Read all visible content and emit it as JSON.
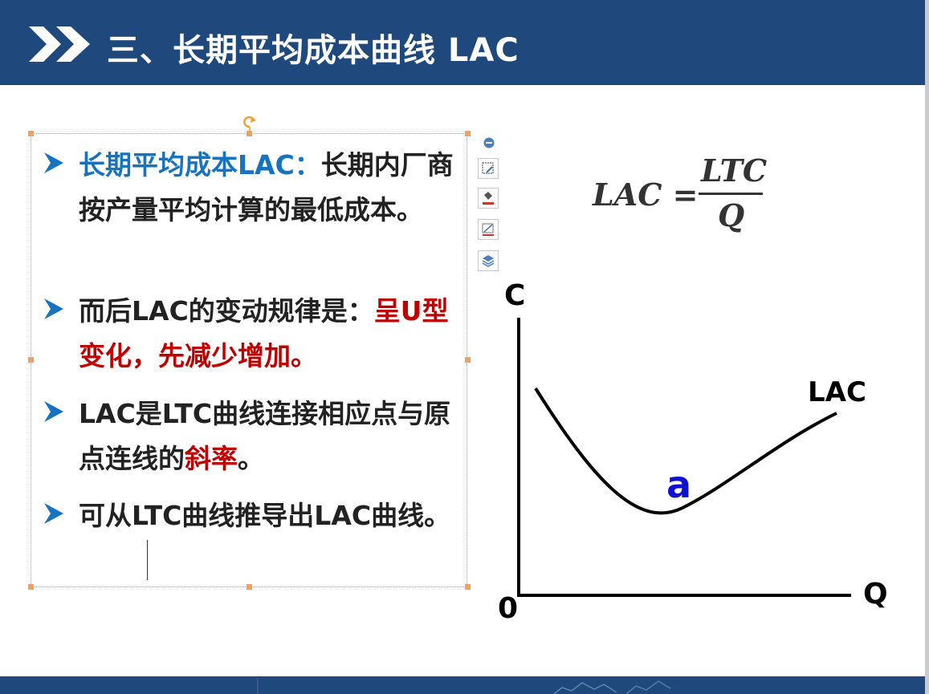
{
  "slide": {
    "title": "三、长期平均成本曲线 LAC",
    "colors": {
      "header": "#1f497d",
      "blue": "#1673c0",
      "red": "#c00000",
      "point_label": "#1010d0"
    }
  },
  "bullets": [
    {
      "parts": [
        {
          "text": "长期平均成本LAC：",
          "style": "blue"
        },
        {
          "text": "长期内厂商按产量平均计算的最低成本。",
          "style": "normal"
        }
      ]
    },
    {
      "parts": [
        {
          "text": "而后LAC的变动规律是：",
          "style": "normal"
        },
        {
          "text": "呈U型变化，先减少增加。",
          "style": "red"
        }
      ]
    },
    {
      "parts": [
        {
          "text": "LAC是LTC曲线连接相应点与原点连线的",
          "style": "normal"
        },
        {
          "text": "斜率",
          "style": "red"
        },
        {
          "text": "。",
          "style": "normal"
        }
      ]
    },
    {
      "parts": [
        {
          "text": "可从LTC曲线推导出LAC曲线。",
          "style": "normal"
        }
      ]
    }
  ],
  "formula": {
    "lhs": "LAC =",
    "numerator": "LTC",
    "denominator": "Q"
  },
  "graph": {
    "y_label": "C",
    "x_label": "Q",
    "origin_label": "0",
    "curve_label": "LAC",
    "point_label": "a"
  },
  "toolbar_icons": [
    "collapse-icon",
    "edit-shape-icon",
    "fill-icon",
    "line-icon",
    "layers-icon"
  ]
}
